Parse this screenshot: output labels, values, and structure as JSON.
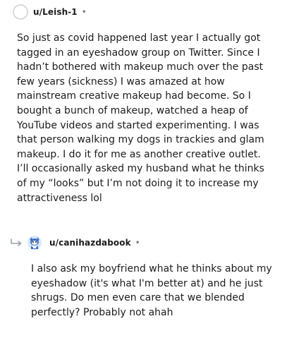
{
  "comments": [
    {
      "username": "u/Leish-1",
      "separator": "•",
      "avatar_icon": "avatar-placeholder-icon",
      "body": "So just as covid happened last year I actually got tagged in an eyeshadow group on Twitter. Since I hadn’t bothered with makeup much over the past few years (sickness) I was amazed at how mainstream creative makeup had become. So I bought a bunch of makeup, watched a heap of YouTube videos and started experimenting. I was that person walking my dogs in trackies and glam makeup. I do it for me as another creative outlet. I’ll occasionally asked my husband what he thinks of my “looks” but I’m not doing it to increase my attractiveness lol"
    },
    {
      "username": "u/canihazdabook",
      "separator": "•",
      "reply_icon": "reply-arrow-icon",
      "avatar_icon": "snoo-avatar-icon",
      "body": "I also ask my boyfriend what he thinks about my eyeshadow (it's what I'm better at) and he just shrugs. Do men even care that we blended perfectly? Probably not ahah"
    }
  ],
  "colors": {
    "text": "#1c1c1c",
    "meta": "#787c7e",
    "avatar_border": "#d7dadc",
    "snoo_blue": "#3b6fc4"
  }
}
